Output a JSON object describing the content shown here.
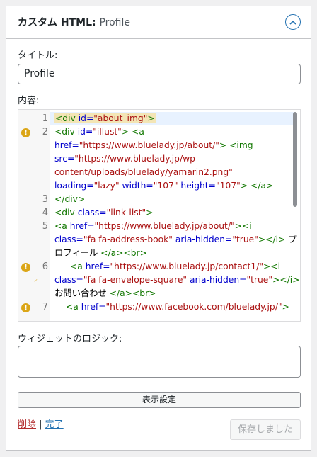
{
  "widget": {
    "title": "カスタム HTML:",
    "subtitle": "Profile",
    "toggle_icon": "chevron-up-icon"
  },
  "title_field": {
    "label": "タイトル:",
    "value": "Profile"
  },
  "content_field": {
    "label": "内容:"
  },
  "code_lines": [
    {
      "num": "1",
      "warn": false
    },
    {
      "num": "2",
      "warn": true
    },
    {
      "num": "3",
      "warn": false
    },
    {
      "num": "4",
      "warn": false
    },
    {
      "num": "5",
      "warn": false
    },
    {
      "num": "6",
      "warn": true
    },
    {
      "num": "7",
      "warn": true
    }
  ],
  "code": {
    "l1": {
      "tag": "<div",
      "attr": " id=",
      "val": "\"about_img\"",
      "end": ">"
    },
    "l2a": {
      "tag": "<div",
      "attr": " id=",
      "val": "\"illust\"",
      "end": "> <a"
    },
    "l2b": {
      "attr": "href=",
      "val": "\"https://www.bluelady.jp/about/\"",
      "end": "> <img"
    },
    "l2c": {
      "attr": "src=",
      "val": "\"https://www.bluelady.jp/wp-"
    },
    "l2d": {
      "val": "content/uploads/bluelady/yamarin2.png\""
    },
    "l2e": {
      "attr1": "loading=",
      "val1": "\"lazy\"",
      "attr2": " width=",
      "val2": "\"107\"",
      "attr3": " height=",
      "val3": "\"107\"",
      "end": "> </a>"
    },
    "l3": {
      "tag": "</div>"
    },
    "l4": {
      "tag": "<div",
      "attr": " class=",
      "val": "\"link-list\"",
      "end": ">"
    },
    "l5a": {
      "tag": "<a",
      "attr": " href=",
      "val": "\"https://www.bluelady.jp/about/\"",
      "end": "><i"
    },
    "l5b": {
      "attr": "class=",
      "val": "\"fa fa-address-book\"",
      "attr2": " aria-hidden=",
      "val2": "\"true\"",
      "end": "></i>",
      "text": " プ"
    },
    "l5c": {
      "text": "ロフィール ",
      "end": "</a><br>"
    },
    "l6a": {
      "tag": "<a",
      "attr": " href=",
      "val": "\"https://www.bluelady.jp/contact1/\"",
      "end": "><i"
    },
    "l6b": {
      "attr": "class=",
      "val": "\"fa fa-envelope-square\"",
      "attr2": " aria-hidden=",
      "val2": "\"true\"",
      "end": "></i>"
    },
    "l6c": {
      "text": "お問い合わせ ",
      "end": "</a><br>"
    },
    "l7a": {
      "tag": "<a",
      "attr": " href=",
      "val": "\"https://www.facebook.com/bluelady.jp/\"",
      "end": ">"
    }
  },
  "logic_field": {
    "label": "ウィジェットのロジック:",
    "value": ""
  },
  "display_button": "表示設定",
  "footer": {
    "delete": "削除",
    "separator": " | ",
    "done": "完了",
    "save": "保存しました"
  },
  "colors": {
    "accent": "#2271b1",
    "warning": "#dba617",
    "tag": "#117700",
    "attr": "#0000cc",
    "string": "#aa1111"
  }
}
